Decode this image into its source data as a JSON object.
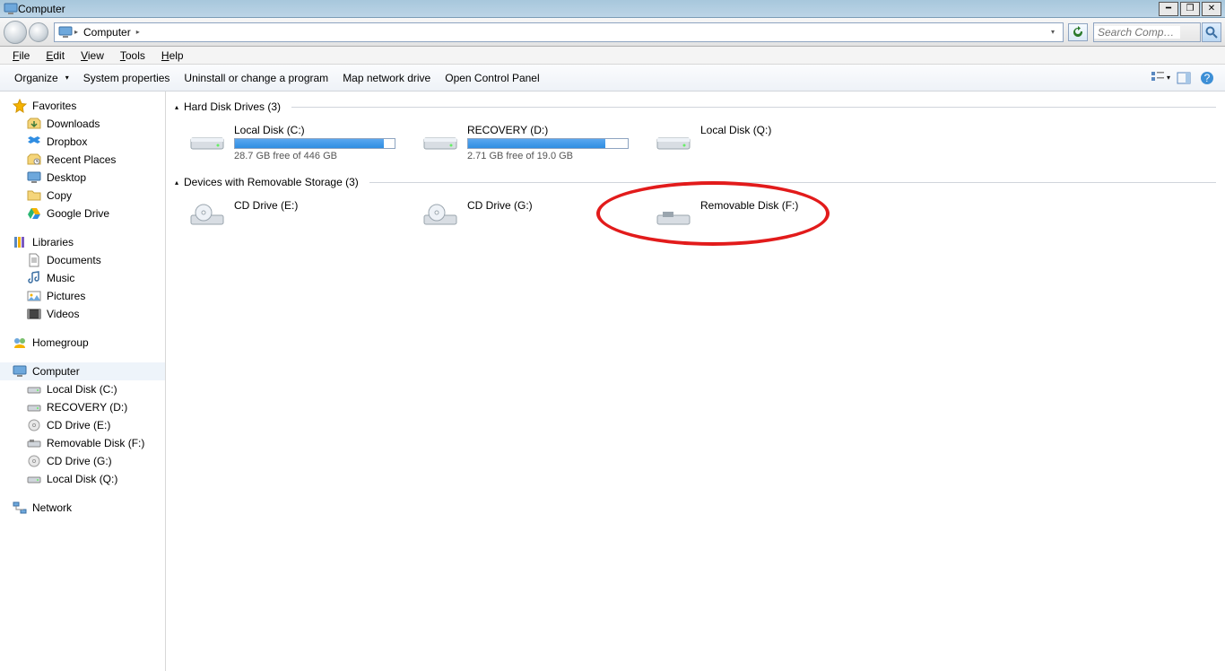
{
  "window": {
    "title": "Computer"
  },
  "breadcrumb": {
    "location": "Computer"
  },
  "search": {
    "placeholder": "Search Comp…"
  },
  "menu": {
    "file": "File",
    "edit": "Edit",
    "view": "View",
    "tools": "Tools",
    "help": "Help"
  },
  "cmd": {
    "organize": "Organize",
    "sysprop": "System properties",
    "uninstall": "Uninstall or change a program",
    "mapdrive": "Map network drive",
    "controlpanel": "Open Control Panel"
  },
  "sidebar": {
    "favorites": {
      "label": "Favorites",
      "items": [
        "Downloads",
        "Dropbox",
        "Recent Places",
        "Desktop",
        "Copy",
        "Google Drive"
      ]
    },
    "libraries": {
      "label": "Libraries",
      "items": [
        "Documents",
        "Music",
        "Pictures",
        "Videos"
      ]
    },
    "homegroup": {
      "label": "Homegroup"
    },
    "computer": {
      "label": "Computer",
      "items": [
        "Local Disk (C:)",
        "RECOVERY (D:)",
        "CD Drive (E:)",
        "Removable Disk (F:)",
        "CD Drive (G:)",
        "Local Disk (Q:)"
      ]
    },
    "network": {
      "label": "Network"
    }
  },
  "groups": {
    "hdd": {
      "header": "Hard Disk Drives (3)"
    },
    "removable": {
      "header": "Devices with Removable Storage (3)"
    }
  },
  "drives": {
    "c": {
      "name": "Local Disk (C:)",
      "free": "28.7 GB free of 446 GB",
      "fillPct": 93
    },
    "d": {
      "name": "RECOVERY (D:)",
      "free": "2.71 GB free of 19.0 GB",
      "fillPct": 86
    },
    "q": {
      "name": "Local Disk (Q:)"
    },
    "e": {
      "name": "CD Drive (E:)"
    },
    "g": {
      "name": "CD Drive (G:)"
    },
    "f": {
      "name": "Removable Disk (F:)"
    }
  }
}
